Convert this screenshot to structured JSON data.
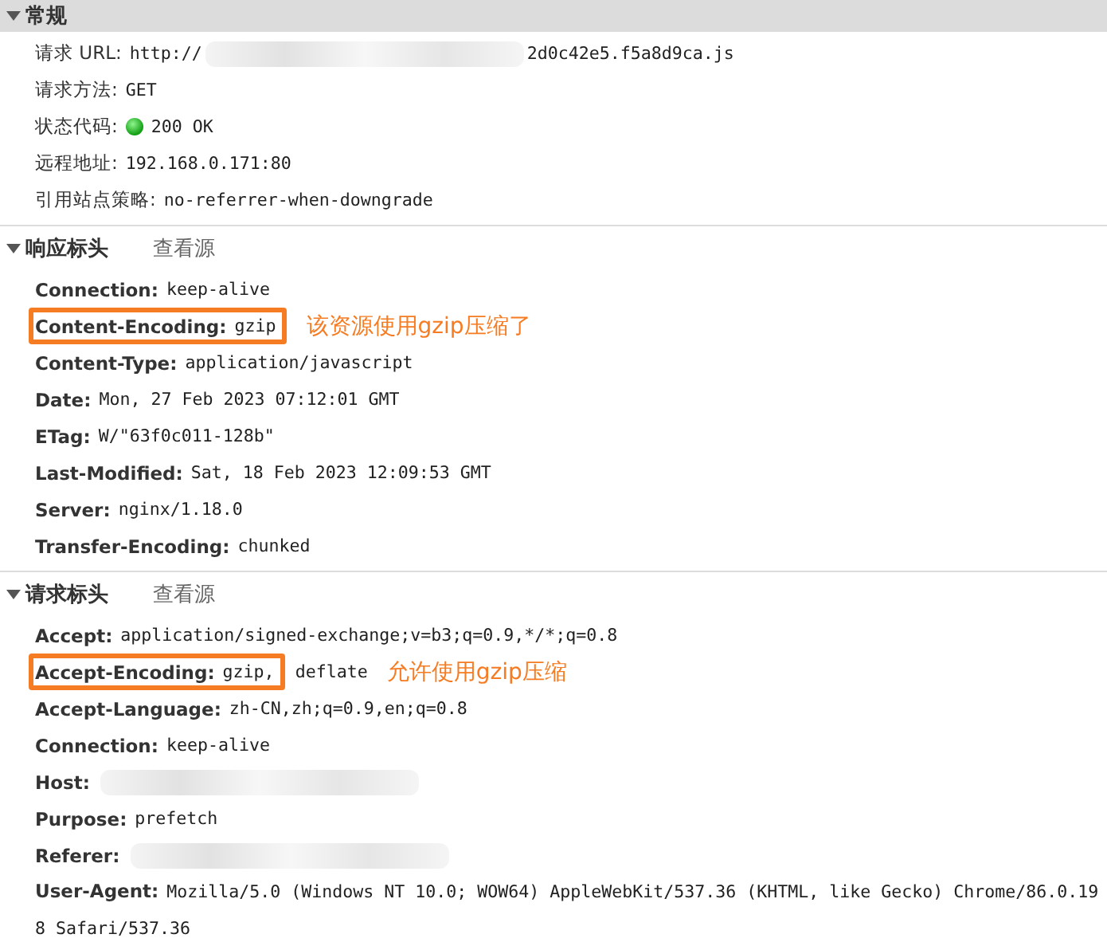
{
  "sections": [
    {
      "title": "常规",
      "shaded": true,
      "rows": [
        {
          "kind": "field",
          "name": "请求 URL:",
          "value": "http://",
          "redacted": true,
          "value_after": "2d0c42e5.f5a8d9ca.js",
          "highlighted": false
        },
        {
          "kind": "field",
          "name": "请求方法:",
          "value": "GET",
          "redacted": false,
          "highlighted": false
        },
        {
          "kind": "status",
          "name": "状态代码:",
          "value": "200 OK",
          "redacted": false,
          "highlighted": false
        },
        {
          "kind": "field",
          "name": "远程地址:",
          "value": "192.168.0.171:80",
          "redacted": false,
          "highlighted": false
        },
        {
          "kind": "field",
          "name": "引用站点策略:",
          "value": "no-referrer-when-downgrade",
          "redacted": false,
          "highlighted": false
        }
      ]
    },
    {
      "title": "响应标头",
      "shaded": false,
      "view_source": "查看源",
      "rows": [
        {
          "kind": "field",
          "name": "Connection:",
          "value": "keep-alive",
          "redacted": false,
          "highlighted": false
        },
        {
          "kind": "field",
          "name": "Content-Encoding:",
          "value": "gzip",
          "redacted": false,
          "highlighted": true,
          "note": "该资源使用gzip压缩了"
        },
        {
          "kind": "field",
          "name": "Content-Type:",
          "value": "application/javascript",
          "redacted": false,
          "highlighted": false
        },
        {
          "kind": "field",
          "name": "Date:",
          "value": "Mon, 27 Feb 2023 07:12:01 GMT",
          "redacted": false,
          "highlighted": false
        },
        {
          "kind": "field",
          "name": "ETag:",
          "value": "W/\"63f0c011-128b\"",
          "redacted": false,
          "highlighted": false
        },
        {
          "kind": "field",
          "name": "Last-Modified:",
          "value": "Sat, 18 Feb 2023 12:09:53 GMT",
          "redacted": false,
          "highlighted": false
        },
        {
          "kind": "field",
          "name": "Server:",
          "value": "nginx/1.18.0",
          "redacted": false,
          "highlighted": false
        },
        {
          "kind": "field",
          "name": "Transfer-Encoding:",
          "value": "chunked",
          "redacted": false,
          "highlighted": false
        }
      ]
    },
    {
      "title": "请求标头",
      "shaded": false,
      "view_source": "查看源",
      "rows": [
        {
          "kind": "field",
          "name": "Accept:",
          "value": "application/signed-exchange;v=b3;q=0.9,*/*;q=0.8",
          "redacted": false,
          "highlighted": false
        },
        {
          "kind": "field",
          "name": "Accept-Encoding:",
          "value": "gzip,",
          "value_after": "deflate",
          "redacted": false,
          "highlighted": true,
          "note": "允许使用gzip压缩"
        },
        {
          "kind": "field",
          "name": "Accept-Language:",
          "value": "zh-CN,zh;q=0.9,en;q=0.8",
          "redacted": false,
          "highlighted": false
        },
        {
          "kind": "field",
          "name": "Connection:",
          "value": "keep-alive",
          "redacted": false,
          "highlighted": false
        },
        {
          "kind": "field",
          "name": "Host:",
          "redacted": true,
          "highlighted": false
        },
        {
          "kind": "field",
          "name": "Purpose:",
          "value": "prefetch",
          "redacted": false,
          "highlighted": false
        },
        {
          "kind": "field",
          "name": "Referer:",
          "redacted": true,
          "highlighted": false
        },
        {
          "kind": "wrapped",
          "name": "User-Agent:",
          "value": "Mozilla/5.0 (Windows NT 10.0; WOW64) AppleWebKit/537.36 (KHTML, like Gecko) Chrome/86.0.198 Safari/537.36",
          "redacted": false,
          "highlighted": false
        }
      ]
    }
  ]
}
